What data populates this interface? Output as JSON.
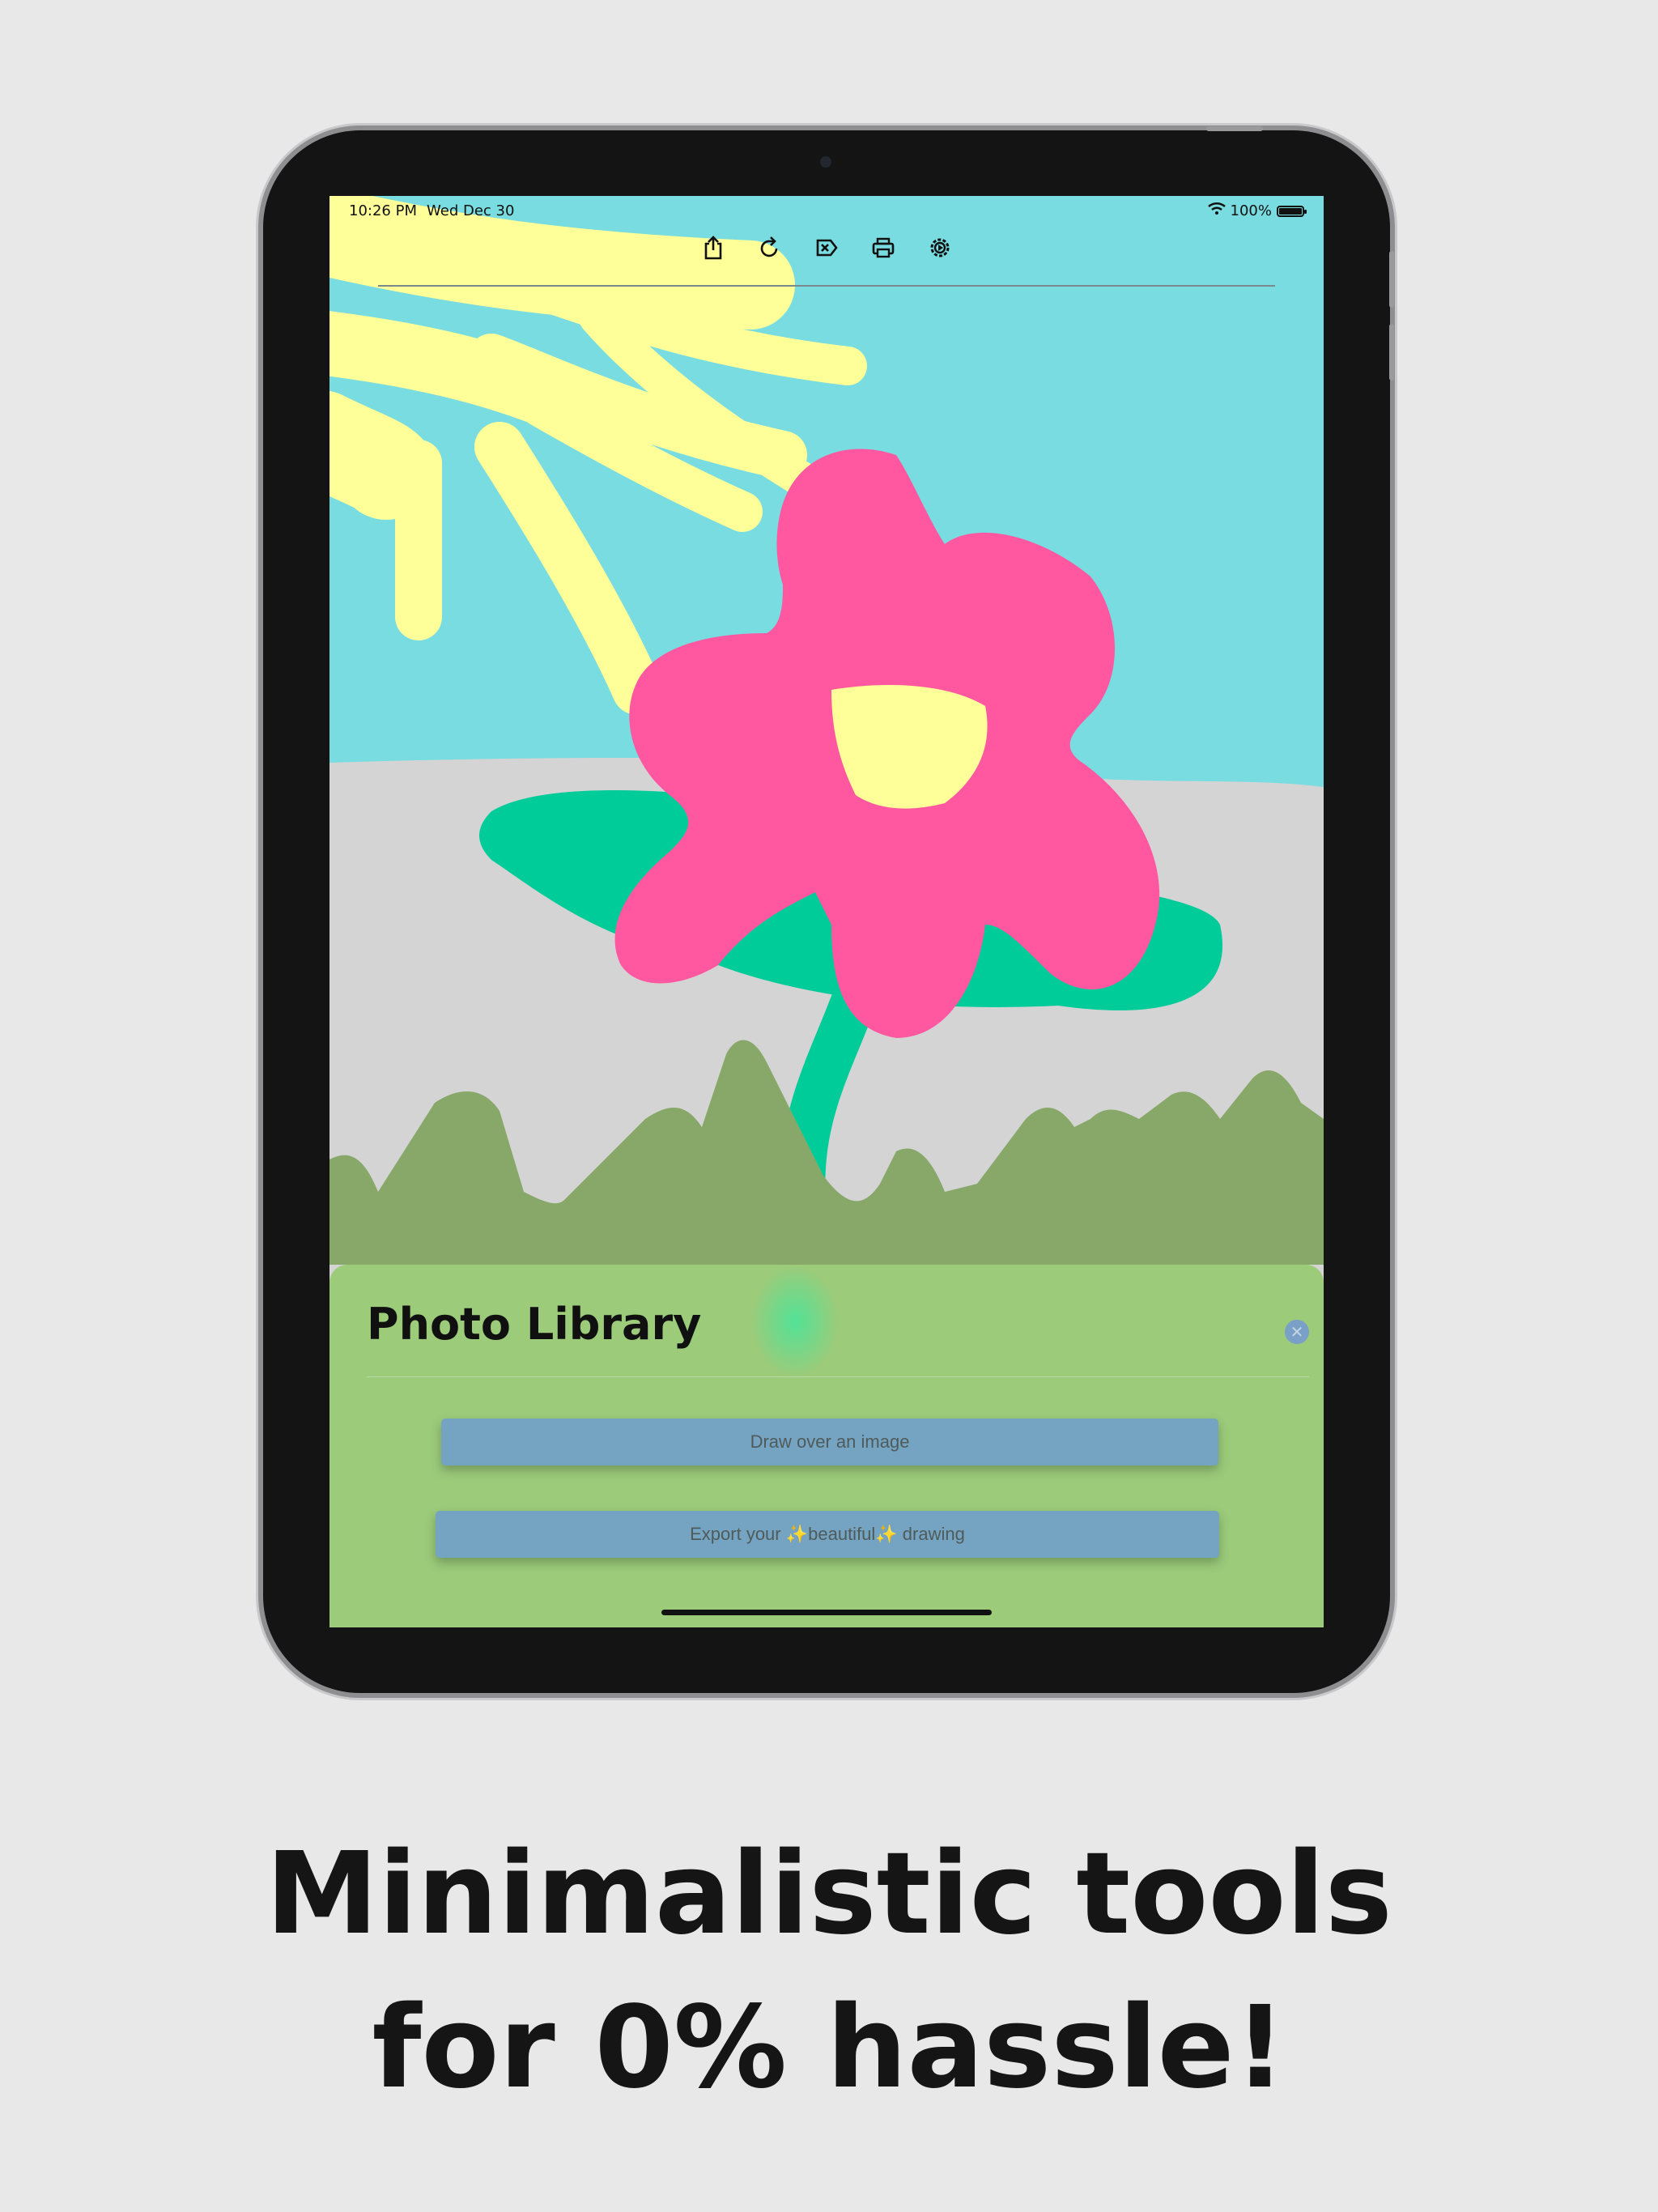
{
  "status_bar": {
    "time": "10:26 PM",
    "date": "Wed Dec 30",
    "battery": "100%"
  },
  "toolbar": {
    "buttons": [
      {
        "icon": "share-icon"
      },
      {
        "icon": "redo-icon"
      },
      {
        "icon": "clear-icon"
      },
      {
        "icon": "print-icon"
      },
      {
        "icon": "settings-icon"
      }
    ]
  },
  "sheet": {
    "title": "Photo Library",
    "close_icon": "close-icon",
    "draw_over_label": "Draw over an image",
    "export_label": "Export your ✨beautiful✨ drawing"
  },
  "tagline": {
    "line1": "Minimalistic tools",
    "line2": "for 0% hassle!"
  },
  "colors": {
    "background": "#e8e8e8",
    "sky": "#78dce0",
    "sun": "#ffff99",
    "petals": "#ff57a0",
    "leaf": "#00cc99",
    "grass": "#88a86a",
    "sheet": "#9ccb7a",
    "button": "#75a4c2"
  }
}
